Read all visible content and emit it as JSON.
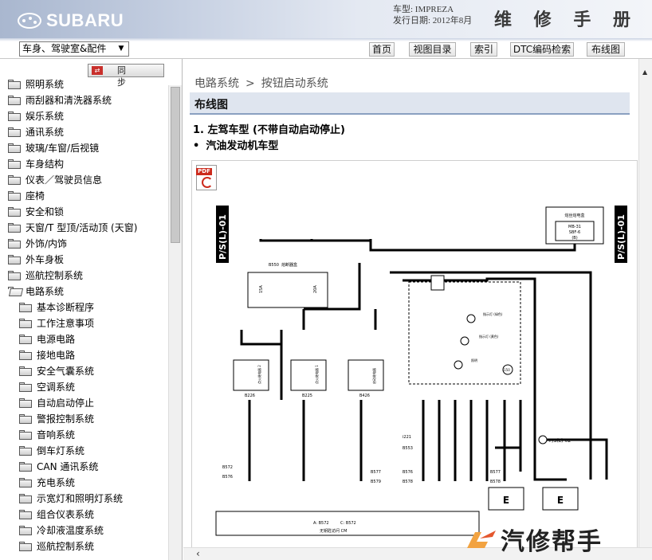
{
  "header": {
    "brand": "SUBARU",
    "model_line": "车型: IMPREZA",
    "date_line": "发行日期: 2012年8月",
    "manual_title": "维 修 手 册"
  },
  "toolbar": {
    "category_selected": "车身、驾驶室&配件",
    "nav": [
      "首页",
      "视图目录",
      "索引",
      "DTC编码检索",
      "布线图"
    ]
  },
  "sidebar": {
    "sync_label": "同 步",
    "items": [
      {
        "label": "照明系统",
        "level": 0,
        "open": false
      },
      {
        "label": "雨刮器和清洗器系统",
        "level": 0,
        "open": false
      },
      {
        "label": "娱乐系统",
        "level": 0,
        "open": false
      },
      {
        "label": "通讯系统",
        "level": 0,
        "open": false
      },
      {
        "label": "玻璃/车窗/后视镜",
        "level": 0,
        "open": false
      },
      {
        "label": "车身结构",
        "level": 0,
        "open": false
      },
      {
        "label": "仪表／驾驶员信息",
        "level": 0,
        "open": false
      },
      {
        "label": "座椅",
        "level": 0,
        "open": false
      },
      {
        "label": "安全和锁",
        "level": 0,
        "open": false
      },
      {
        "label": "天窗/T 型顶/活动顶 (天窗)",
        "level": 0,
        "open": false
      },
      {
        "label": "外饰/内饰",
        "level": 0,
        "open": false
      },
      {
        "label": "外车身板",
        "level": 0,
        "open": false
      },
      {
        "label": "巡航控制系统",
        "level": 0,
        "open": false
      },
      {
        "label": "电路系统",
        "level": 0,
        "open": true
      },
      {
        "label": "基本诊断程序",
        "level": 1,
        "open": false
      },
      {
        "label": "工作注意事项",
        "level": 1,
        "open": false
      },
      {
        "label": "电源电路",
        "level": 1,
        "open": false
      },
      {
        "label": "接地电路",
        "level": 1,
        "open": false
      },
      {
        "label": "安全气囊系统",
        "level": 1,
        "open": false
      },
      {
        "label": "空调系统",
        "level": 1,
        "open": false
      },
      {
        "label": "自动启动停止",
        "level": 1,
        "open": false
      },
      {
        "label": "警报控制系统",
        "level": 1,
        "open": false
      },
      {
        "label": "音响系统",
        "level": 1,
        "open": false
      },
      {
        "label": "倒车灯系统",
        "level": 1,
        "open": false
      },
      {
        "label": "CAN 通讯系统",
        "level": 1,
        "open": false
      },
      {
        "label": "充电系统",
        "level": 1,
        "open": false
      },
      {
        "label": "示宽灯和照明灯系统",
        "level": 1,
        "open": false
      },
      {
        "label": "组合仪表系统",
        "level": 1,
        "open": false
      },
      {
        "label": "冷却液温度系统",
        "level": 1,
        "open": false
      },
      {
        "label": "巡航控制系统",
        "level": 1,
        "open": false
      }
    ]
  },
  "content": {
    "breadcrumb_parent": "电路系统",
    "breadcrumb_sep": ">",
    "breadcrumb_current": "按钮启动系统",
    "section_title": "布线图",
    "subtitle1": "1. 左驾车型 (不带自动启动停止)",
    "subtitle2": "汽油发动机车型",
    "subtitle2_bullet": "•"
  },
  "diagram": {
    "side_label": "P/S(L)-01",
    "offpage_label": "P/S(L)-02",
    "pdf_badge": "PDF",
    "fuse_box_title": "熔丝熔电盒",
    "fuse_box_lines": [
      "MB-31",
      "SBF-6",
      "(B)"
    ],
    "fuse_label": "B550",
    "fuse_caption": "熔断器盒",
    "fuse_values": [
      "15A",
      "20A"
    ],
    "relay_labels": [
      "B226",
      "B225",
      "B426"
    ],
    "relay_captions": [
      "点火继电器 2",
      "点火继电器 1",
      "启动继电器"
    ],
    "connector_refs_left": [
      "B572",
      "B576"
    ],
    "connector_refs_mid": [
      "B577",
      "B579"
    ],
    "connector_refs_right1": [
      "B577",
      "B578"
    ],
    "connector_refs_right2": [
      "i221",
      "B553"
    ],
    "connector_refs_right3": [
      "B576",
      "B578"
    ],
    "indicator_labels": [
      "指示灯 (绿色)",
      "指示灯 (黄色)",
      "照明"
    ],
    "switch_ref": "i150",
    "cm_labels": [
      "A: B572",
      "C: B572"
    ],
    "cm_caption": "无钥匙访问 CM",
    "ground_labels": [
      "E",
      "E"
    ],
    "wire_colors": [
      "W",
      "W",
      "L",
      "R",
      "BR",
      "G",
      "Y",
      "L/W",
      "B"
    ]
  },
  "watermark": {
    "text": "汽修帮手"
  }
}
